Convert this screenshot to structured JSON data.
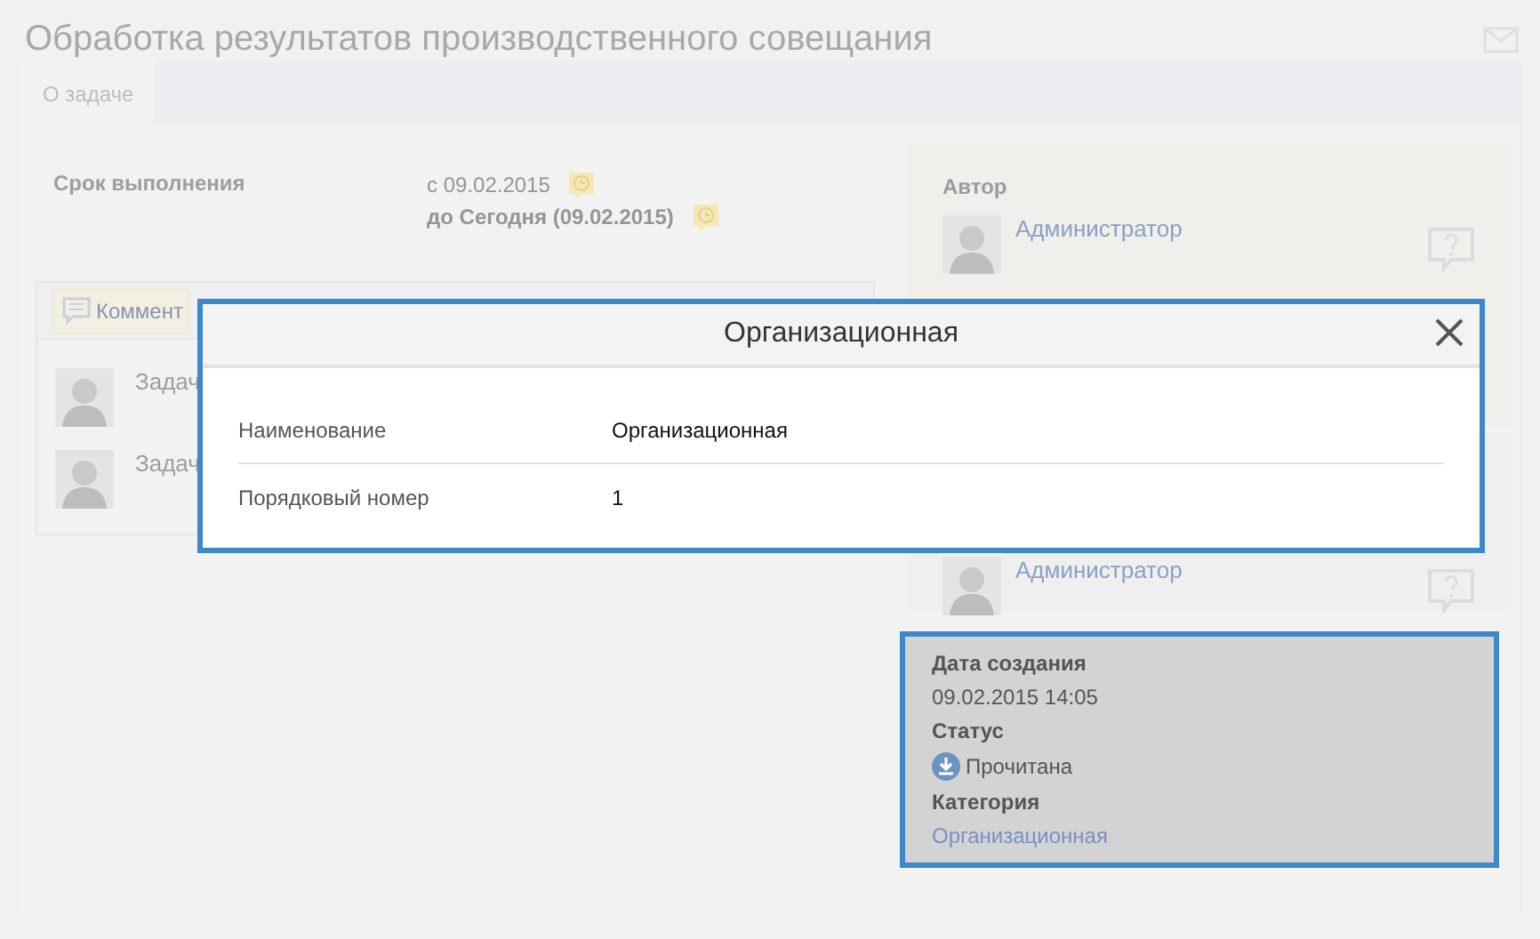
{
  "header": {
    "title": "Обработка результатов производственного совещания"
  },
  "tabs": [
    {
      "label": "О задаче",
      "selected": true
    }
  ],
  "deadline": {
    "label": "Срок выполнения",
    "from": "с 09.02.2015",
    "to": "до Сегодня (09.02.2015)"
  },
  "comments": {
    "button": "Коммент",
    "items": [
      {
        "text": "Задач"
      },
      {
        "text": "Задач"
      }
    ]
  },
  "author": {
    "label": "Автор",
    "name": "Администратор"
  },
  "second_person": {
    "name": "Администратор"
  },
  "info": {
    "fields": [
      {
        "label": "Дата создания",
        "value": "09.02.2015 14:05",
        "kind": "text"
      },
      {
        "label": "Статус",
        "value": "Прочитана",
        "kind": "status"
      },
      {
        "label": "Категория",
        "value": "Организационная",
        "kind": "link"
      }
    ]
  },
  "dialog": {
    "title": "Организационная",
    "rows": [
      {
        "label": "Наименование",
        "value": "Организационная"
      },
      {
        "label": "Порядковый номер",
        "value": "1"
      }
    ]
  }
}
